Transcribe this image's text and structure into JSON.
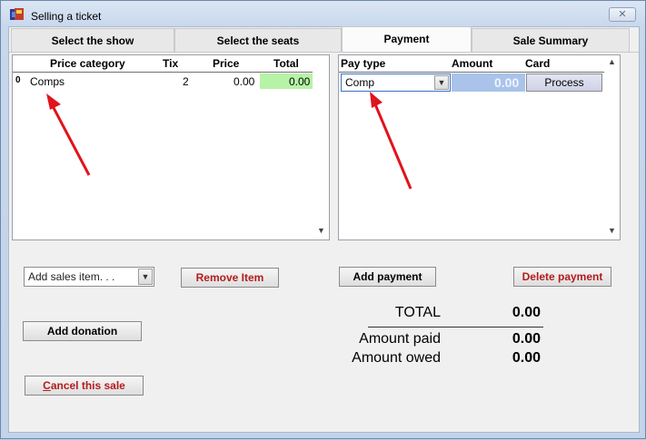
{
  "window": {
    "title": "Selling a ticket",
    "close_symbol": "✕"
  },
  "tabs": [
    {
      "label": "Select the show",
      "active": false
    },
    {
      "label": "Select the seats",
      "active": false
    },
    {
      "label": "Payment",
      "active": true
    },
    {
      "label": "Sale Summary",
      "active": false
    }
  ],
  "price_grid": {
    "headers": {
      "category": "Price category",
      "tix": "Tix",
      "price": "Price",
      "total": "Total"
    },
    "rows": [
      {
        "marker": "0",
        "category": "Comps",
        "tix": "2",
        "price": "0.00",
        "total": "0.00"
      }
    ]
  },
  "payment_grid": {
    "headers": {
      "pay_type": "Pay type",
      "amount": "Amount",
      "card": "Card"
    },
    "rows": [
      {
        "pay_type": "Comp",
        "amount": "0.00",
        "card_button": "Process"
      }
    ]
  },
  "actions": {
    "sales_item_placeholder": "Add sales item. . .",
    "remove_item": "Remove Item",
    "add_payment": "Add payment",
    "delete_payment": "Delete payment",
    "add_donation": "Add donation",
    "cancel_sale": "Cancel this sale"
  },
  "totals": {
    "total_label": "TOTAL",
    "total_value": "0.00",
    "paid_label": "Amount paid",
    "paid_value": "0.00",
    "owed_label": "Amount owed",
    "owed_value": "0.00"
  },
  "colors": {
    "total_highlight": "#b7f3a6",
    "amount_highlight": "#a9c3ea",
    "annotation_arrow": "#e0141c",
    "danger_text": "#b41c1c"
  }
}
